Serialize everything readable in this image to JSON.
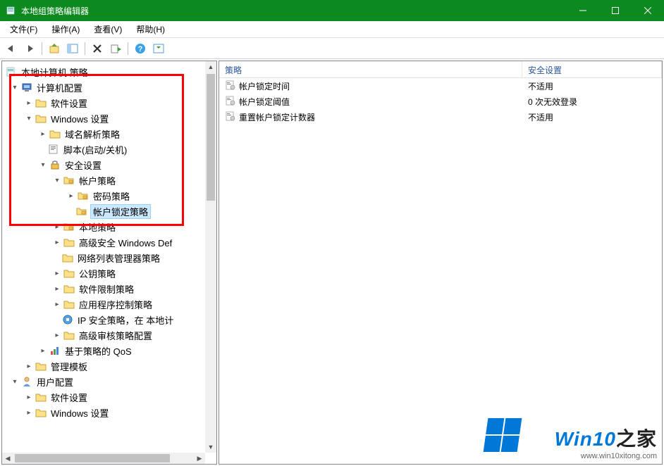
{
  "title": "本地组策略编辑器",
  "menu": {
    "file": "文件(F)",
    "action": "操作(A)",
    "view": "查看(V)",
    "help": "帮助(H)"
  },
  "tree": {
    "root": "本地计算机 策略",
    "computer_config": "计算机配置",
    "software_settings": "软件设置",
    "windows_settings": "Windows 设置",
    "name_resolution": "域名解析策略",
    "scripts": "脚本(启动/关机)",
    "security_settings": "安全设置",
    "account_policies": "帐户策略",
    "password_policy": "密码策略",
    "account_lockout": "帐户锁定策略",
    "local_policies": "本地策略",
    "advanced_fw": "高级安全 Windows Def",
    "network_list": "网络列表管理器策略",
    "public_key": "公钥策略",
    "software_restriction": "软件限制策略",
    "app_control": "应用程序控制策略",
    "ip_security": "IP 安全策略，在 本地计",
    "advanced_audit": "高级审核策略配置",
    "qos": "基于策略的 QoS",
    "admin_templates": "管理模板",
    "user_config": "用户配置",
    "user_software": "软件设置",
    "user_windows": "Windows 设置"
  },
  "list": {
    "col_policy": "策略",
    "col_security": "安全设置",
    "rows": [
      {
        "name": "帐户锁定时间",
        "value": "不适用"
      },
      {
        "name": "帐户锁定阈值",
        "value": "0 次无效登录"
      },
      {
        "name": "重置帐户锁定计数器",
        "value": "不适用"
      }
    ]
  },
  "watermark": {
    "brand1": "Win10",
    "brand2": "之家",
    "url": "www.win10xitong.com"
  }
}
